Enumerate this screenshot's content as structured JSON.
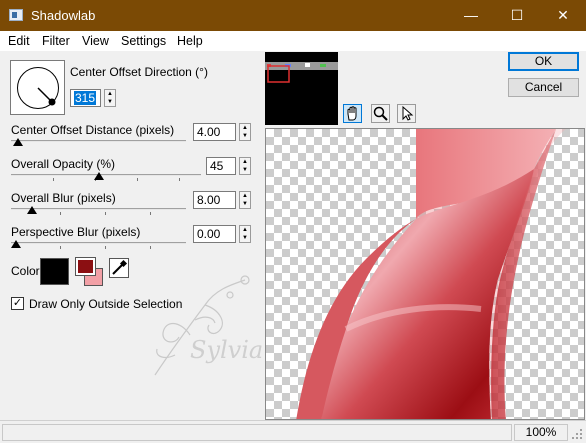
{
  "window": {
    "title": "Shadowlab",
    "minimize_glyph": "—",
    "maximize_glyph": "☐",
    "close_glyph": "✕"
  },
  "menu": [
    "Edit",
    "Filter",
    "View",
    "Settings",
    "Help"
  ],
  "settings": {
    "direction_label": "Center Offset Direction (°)",
    "direction_value": "315",
    "distance_label": "Center Offset Distance (pixels)",
    "distance_value": "4.00",
    "opacity_label": "Overall Opacity (%)",
    "opacity_value": "45",
    "blur_label": "Overall Blur (pixels)",
    "blur_value": "8.00",
    "perspective_label": "Perspective Blur (pixels)",
    "perspective_value": "0.00",
    "color_label": "Color",
    "checkbox_label": "Draw Only Outside Selection",
    "checkbox_checked": true
  },
  "buttons": {
    "ok": "OK",
    "cancel": "Cancel"
  },
  "tools": [
    "hand-icon",
    "zoom-icon",
    "arrow-pointer-icon"
  ],
  "watermark": "Sylviane",
  "status": {
    "zoom": "100%"
  },
  "colors": {
    "titlebar": "#7b4a05",
    "shadow_color": "#000000",
    "primary_color": "#8b0f12",
    "secondary_color": "#f2a0a6",
    "ribbon_red": "#c8333a"
  }
}
